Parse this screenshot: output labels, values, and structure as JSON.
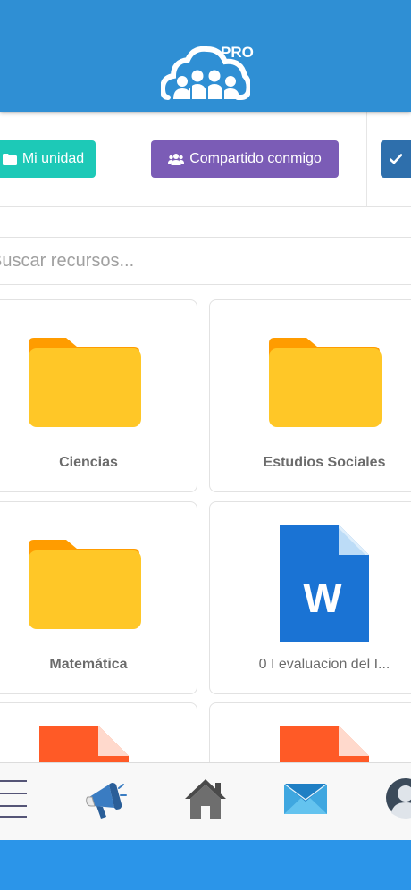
{
  "header": {
    "logo_badge": "PRO",
    "brand_color": "#2f8fd4"
  },
  "tabs": {
    "mine_label": "Mi unidad",
    "shared_label": "Compartido conmigo",
    "mine_icon": "folder-icon",
    "shared_icon": "users-icon",
    "third_icon": "check-icon"
  },
  "search": {
    "placeholder": "Buscar recursos..."
  },
  "files": [
    {
      "name": "Ciencias",
      "type": "folder"
    },
    {
      "name": "Estudios Sociales",
      "type": "folder"
    },
    {
      "name": "Matemática",
      "type": "folder"
    },
    {
      "name": "0 I evaluacion del I...",
      "type": "word-document"
    },
    {
      "name": "",
      "type": "document"
    },
    {
      "name": "",
      "type": "document"
    }
  ],
  "bottom_nav": [
    {
      "icon": "menu-icon"
    },
    {
      "icon": "megaphone-icon"
    },
    {
      "icon": "home-icon"
    },
    {
      "icon": "mail-icon"
    },
    {
      "icon": "avatar-icon"
    }
  ],
  "colors": {
    "tab_mine": "#1dc9b7",
    "tab_shared": "#7b5cb6",
    "tab_third": "#2e6fac",
    "folder": "#ffc727",
    "word": "#1a73d4",
    "bottom_bar": "#2b95e9"
  }
}
